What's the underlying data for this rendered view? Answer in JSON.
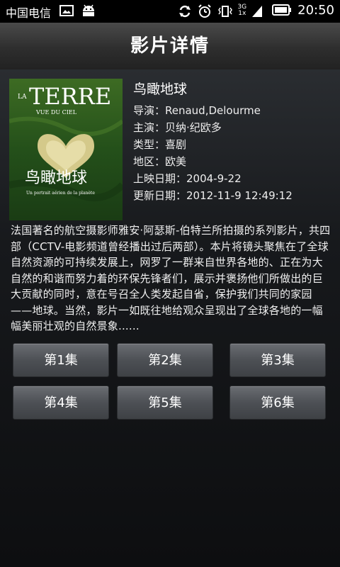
{
  "status_bar": {
    "carrier": "中国电信",
    "network": "3G",
    "network_sub": "1x",
    "time": "20:50"
  },
  "header": {
    "title": "影片详情"
  },
  "poster": {
    "headline": "TERRE",
    "prefix": "LA",
    "subline": "VUE DU CIEL",
    "cn_title": "鸟瞰地球",
    "tagline": "Un portrait aérien de la planète"
  },
  "movie": {
    "title": "鸟瞰地球",
    "director": "导演：Renaud,Delourme",
    "cast": "主演：贝纳·纪欧多",
    "genre": "类型：喜剧",
    "region": "地区：欧美",
    "release": "上映日期：2004-9-22",
    "updated": "更新日期：2012-11-9 12:49:12",
    "description": "法国著名的航空摄影师雅安·阿瑟斯-伯特兰所拍摄的系列影片，共四部（CCTV-电影频道曾经播出过后两部）。本片将镜头聚焦在了全球自然资源的可持续发展上，网罗了一群来自世界各地的、正在为大自然的和谐而努力着的环保先锋者们，展示并褒扬他们所做出的巨大贡献的同时，意在号召全人类发起自省，保护我们共同的家园——地球。当然，影片一如既往地给观众呈现出了全球各地的一幅幅美丽壮观的自然景象......"
  },
  "episodes": [
    "第1集",
    "第2集",
    "第3集",
    "第4集",
    "第5集",
    "第6集"
  ]
}
